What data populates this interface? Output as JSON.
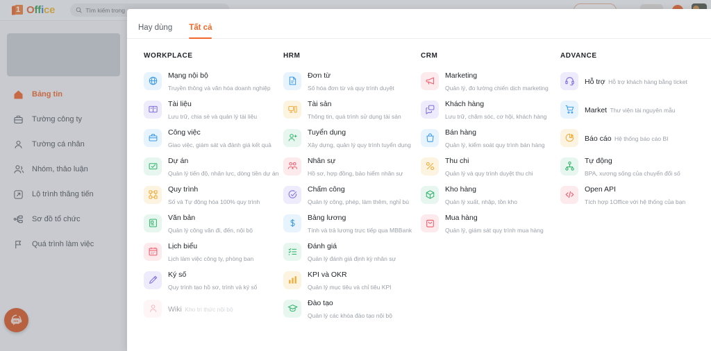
{
  "brand": {
    "logo_text_parts": [
      "O",
      "ff",
      "i",
      "ce"
    ],
    "logo_digit": "1",
    "accent_color": "#f2682a",
    "sidebar_active_color": "#ee6023"
  },
  "topbar": {
    "search": {
      "placeholder": "Tìm kiếm trong",
      "icon": "search-icon"
    }
  },
  "sidebar": {
    "items": [
      {
        "label": "Bảng tin",
        "icon": "home-icon",
        "active": true
      },
      {
        "label": "Tường công ty",
        "icon": "briefcase-icon",
        "active": false
      },
      {
        "label": "Tường cá nhân",
        "icon": "user-icon",
        "active": false
      },
      {
        "label": "Nhóm, thảo luận",
        "icon": "users-icon",
        "active": false
      },
      {
        "label": "Lộ trình thăng tiến",
        "icon": "arrow-up-right-box-icon",
        "active": false
      },
      {
        "label": "Sơ đồ tổ chức",
        "icon": "org-chart-icon",
        "active": false
      },
      {
        "label": "Quá trình làm việc",
        "icon": "flag-icon",
        "active": false
      }
    ]
  },
  "support_button": {
    "icon": "headset-chat-icon",
    "color": "#d9531e"
  },
  "panel": {
    "tabs": [
      {
        "label": "Hay dùng",
        "active": false
      },
      {
        "label": "Tất cả",
        "active": true
      }
    ],
    "columns": [
      {
        "title": "WORKPLACE",
        "apps": [
          {
            "name": "Mạng nội bộ",
            "desc": "Truyền thông và văn hóa doanh nghiệp",
            "icon": "globe-icon",
            "color": "#3d9ae8",
            "bg": "#e8f4fd",
            "disabled": false
          },
          {
            "name": "Tài liệu",
            "desc": "Lưu trữ, chia sẻ và quản lý tài liệu",
            "icon": "book-icon",
            "color": "#7e6ce0",
            "bg": "#eeebfc",
            "disabled": false
          },
          {
            "name": "Công việc",
            "desc": "Giao việc, giám sát và đánh giá kết quả",
            "icon": "briefcase-icon",
            "color": "#3d9ae8",
            "bg": "#e8f4fd",
            "disabled": false
          },
          {
            "name": "Dự án",
            "desc": "Quản lý tiến độ, nhân lực, dòng tiền dự án",
            "icon": "project-check-icon",
            "color": "#2fb36b",
            "bg": "#e7f7ef",
            "disabled": false
          },
          {
            "name": "Quy trình",
            "desc": "Số và Tự động hóa 100% quy trình",
            "icon": "workflow-icon",
            "color": "#f0ad3c",
            "bg": "#fdf3e1",
            "disabled": false
          },
          {
            "name": "Văn bản",
            "desc": "Quản lý công văn đi, đến, nội bộ",
            "icon": "document-icon",
            "color": "#2fb36b",
            "bg": "#e7f7ef",
            "disabled": false
          },
          {
            "name": "Lịch biểu",
            "desc": "Lịch làm việc công ty, phòng ban",
            "icon": "calendar-icon",
            "color": "#ef5a6b",
            "bg": "#fdeaec",
            "disabled": false
          },
          {
            "name": "Ký số",
            "desc": "Quy trình tạo hồ sơ, trình và ký số",
            "icon": "pen-icon",
            "color": "#7e6ce0",
            "bg": "#eeebfc",
            "disabled": false
          },
          {
            "name": "Wiki",
            "desc": "Kho tri thức nội bộ",
            "icon": "wiki-icon",
            "color": "#ef5a6b",
            "bg": "#fdeaec",
            "disabled": true
          }
        ]
      },
      {
        "title": "HRM",
        "apps": [
          {
            "name": "Đơn từ",
            "desc": "Số hóa đơn từ và quy trình duyệt",
            "icon": "form-icon",
            "color": "#3d9ae8",
            "bg": "#e8f4fd",
            "disabled": false
          },
          {
            "name": "Tài sản",
            "desc": "Thông tin, quá trình sử dụng tài sản",
            "icon": "monitor-icon",
            "color": "#f0ad3c",
            "bg": "#fdf3e1",
            "disabled": false
          },
          {
            "name": "Tuyển dụng",
            "desc": "Xây dựng, quản lý quy trình tuyển dụng",
            "icon": "user-plus-icon",
            "color": "#2fb36b",
            "bg": "#e7f7ef",
            "disabled": false
          },
          {
            "name": "Nhân sự",
            "desc": "Hồ sơ, hợp đồng, bảo hiểm nhân sự",
            "icon": "people-icon",
            "color": "#ef5a6b",
            "bg": "#fdeaec",
            "disabled": false
          },
          {
            "name": "Chấm công",
            "desc": "Quản lý công, phép, làm thêm, nghỉ bù",
            "icon": "check-circle-icon",
            "color": "#7e6ce0",
            "bg": "#eeebfc",
            "disabled": false
          },
          {
            "name": "Bảng lương",
            "desc": "Tính và trả lương trực tiếp qua MBBank",
            "icon": "dollar-icon",
            "color": "#3d9ae8",
            "bg": "#e8f4fd",
            "disabled": false
          },
          {
            "name": "Đánh giá",
            "desc": "Quản lý đánh giá định kỳ nhân sự",
            "icon": "checklist-icon",
            "color": "#2fb36b",
            "bg": "#e7f7ef",
            "disabled": false
          },
          {
            "name": "KPI và OKR",
            "desc": "Quản lý mục tiêu và chỉ tiêu KPI",
            "icon": "bar-chart-icon",
            "color": "#f0ad3c",
            "bg": "#fdf3e1",
            "disabled": false
          },
          {
            "name": "Đào tạo",
            "desc": "Quản lý các khóa đào tạo nội bộ",
            "icon": "graduation-cap-icon",
            "color": "#2fb36b",
            "bg": "#e7f7ef",
            "disabled": false
          }
        ]
      },
      {
        "title": "CRM",
        "apps": [
          {
            "name": "Marketing",
            "desc": "Quản lý, đo lường chiến dịch marketing",
            "icon": "megaphone-icon",
            "color": "#ef5a6b",
            "bg": "#fdeaec",
            "disabled": false
          },
          {
            "name": "Khách hàng",
            "desc": "Lưu trữ, chăm sóc, cơ hội, khách hàng",
            "icon": "contacts-icon",
            "color": "#7e6ce0",
            "bg": "#eeebfc",
            "disabled": false
          },
          {
            "name": "Bán hàng",
            "desc": "Quản lý, kiểm soát quy trình bán hàng",
            "icon": "bag-icon",
            "color": "#3d9ae8",
            "bg": "#e8f4fd",
            "disabled": false
          },
          {
            "name": "Thu chi",
            "desc": "Quản lý và quy trình duyệt thu chi",
            "icon": "percent-icon",
            "color": "#f0ad3c",
            "bg": "#fdf3e1",
            "disabled": false
          },
          {
            "name": "Kho hàng",
            "desc": "Quản lý xuất, nhập, tồn kho",
            "icon": "box-icon",
            "color": "#2fb36b",
            "bg": "#e7f7ef",
            "disabled": false
          },
          {
            "name": "Mua hàng",
            "desc": "Quản lý, giám sát quy trình mua hàng",
            "icon": "shopping-bag-icon",
            "color": "#ef5a6b",
            "bg": "#fdeaec",
            "disabled": false
          }
        ]
      },
      {
        "title": "ADVANCE",
        "apps": [
          {
            "name": "Hỗ trợ",
            "desc": "Hỗ trợ khách hàng bằng ticket",
            "icon": "headset-icon",
            "color": "#7e6ce0",
            "bg": "#eeebfc",
            "disabled": false
          },
          {
            "name": "Market",
            "desc": "Thư viện tài nguyên mẫu",
            "icon": "cart-icon",
            "color": "#3d9ae8",
            "bg": "#e8f4fd",
            "disabled": false
          },
          {
            "name": "Báo cáo",
            "desc": "Hệ thống báo cáo BI",
            "icon": "pie-chart-icon",
            "color": "#f0ad3c",
            "bg": "#fdf3e1",
            "disabled": false
          },
          {
            "name": "Tự động",
            "desc": "BPA, xương sống của chuyển đổi số",
            "icon": "hierarchy-icon",
            "color": "#2fb36b",
            "bg": "#e7f7ef",
            "disabled": false
          },
          {
            "name": "Open API",
            "desc": "Tích hợp 1Office với hệ thống của bạn",
            "icon": "code-icon",
            "color": "#ef5a6b",
            "bg": "#fdeaec",
            "disabled": false
          }
        ]
      }
    ]
  }
}
